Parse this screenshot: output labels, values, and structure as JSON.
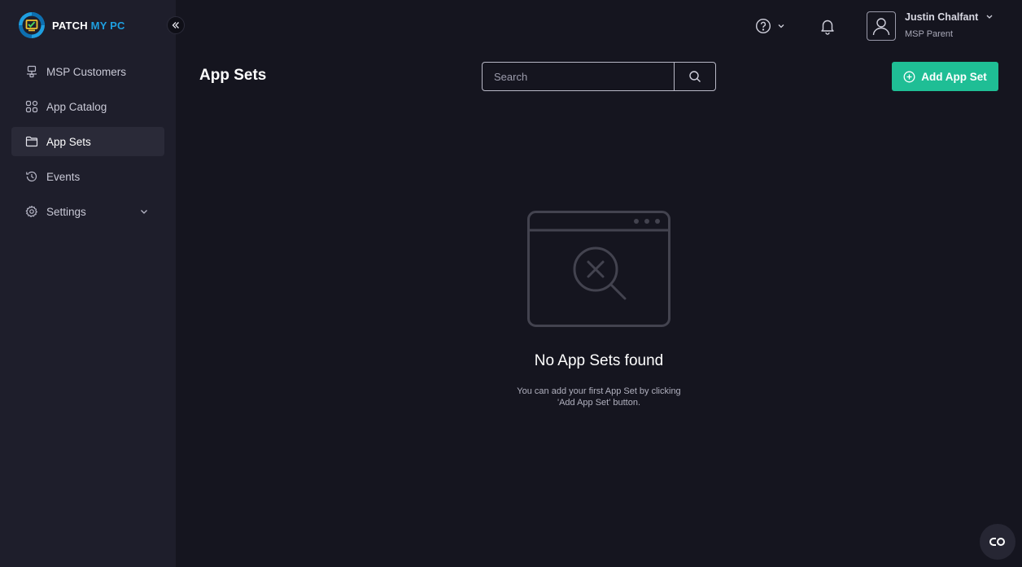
{
  "brand": {
    "word1": "PATCH",
    "word2": "MY PC",
    "accent": "#1e9fe0"
  },
  "sidebar": {
    "items": [
      {
        "label": "MSP Customers",
        "icon": "network-icon"
      },
      {
        "label": "App Catalog",
        "icon": "grid-icon"
      },
      {
        "label": "App Sets",
        "icon": "folder-icon",
        "active": true
      },
      {
        "label": "Events",
        "icon": "history-icon"
      },
      {
        "label": "Settings",
        "icon": "gear-icon"
      }
    ]
  },
  "topbar": {
    "user_name": "Justin Chalfant",
    "user_role": "MSP Parent"
  },
  "header": {
    "title": "App Sets",
    "search_placeholder": "Search",
    "add_button": "Add App Set",
    "add_button_color": "#1fbe95"
  },
  "empty_state": {
    "title": "No App Sets found",
    "description": "You can add your first App Set by clicking 'Add App Set' button."
  }
}
